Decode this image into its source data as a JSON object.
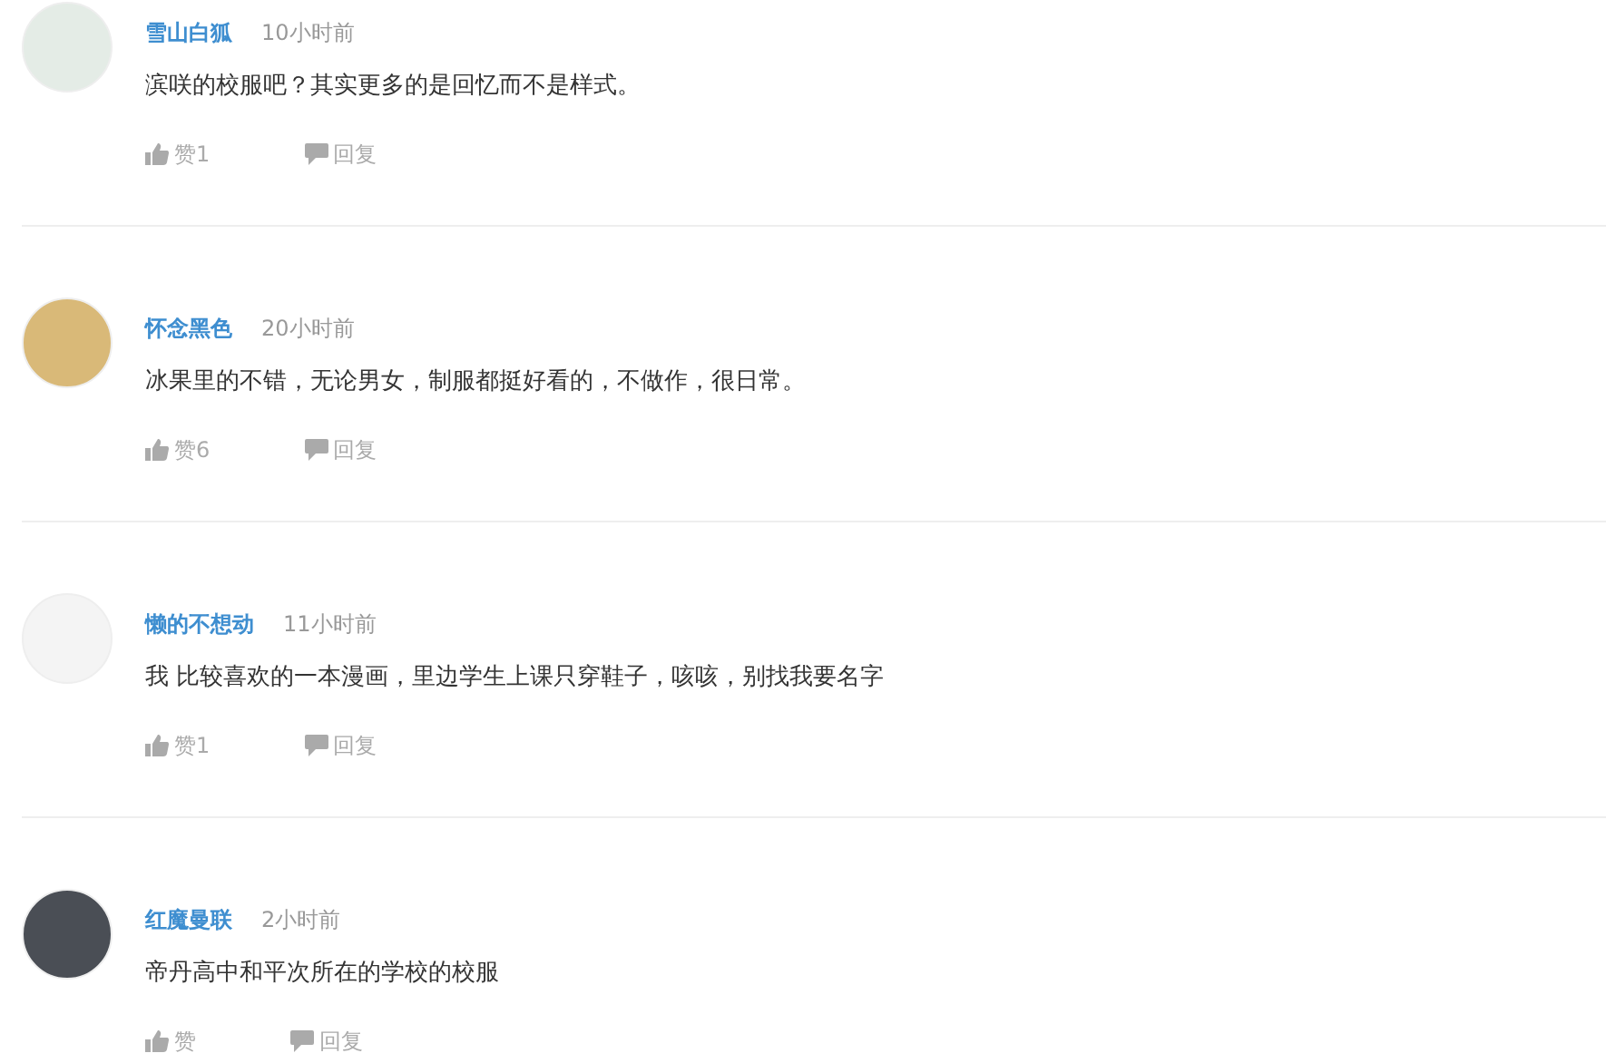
{
  "comments": [
    {
      "author": "雪山白狐",
      "time": "10小时前",
      "text": "滨咲的校服吧？其实更多的是回忆而不是样式。",
      "like": "赞1",
      "reply": "回复"
    },
    {
      "author": "怀念黑色",
      "time": "20小时前",
      "text": "冰果里的不错，无论男女，制服都挺好看的，不做作，很日常。",
      "like": "赞6",
      "reply": "回复"
    },
    {
      "author": "懒的不想动",
      "time": "11小时前",
      "text": "我 比较喜欢的一本漫画，里边学生上课只穿鞋子，咳咳，别找我要名字",
      "like": "赞1",
      "reply": "回复"
    },
    {
      "author": "红魔曼联",
      "time": "2小时前",
      "text": "帝丹高中和平次所在的学校的校服",
      "like": "赞",
      "reply": "回复"
    }
  ]
}
